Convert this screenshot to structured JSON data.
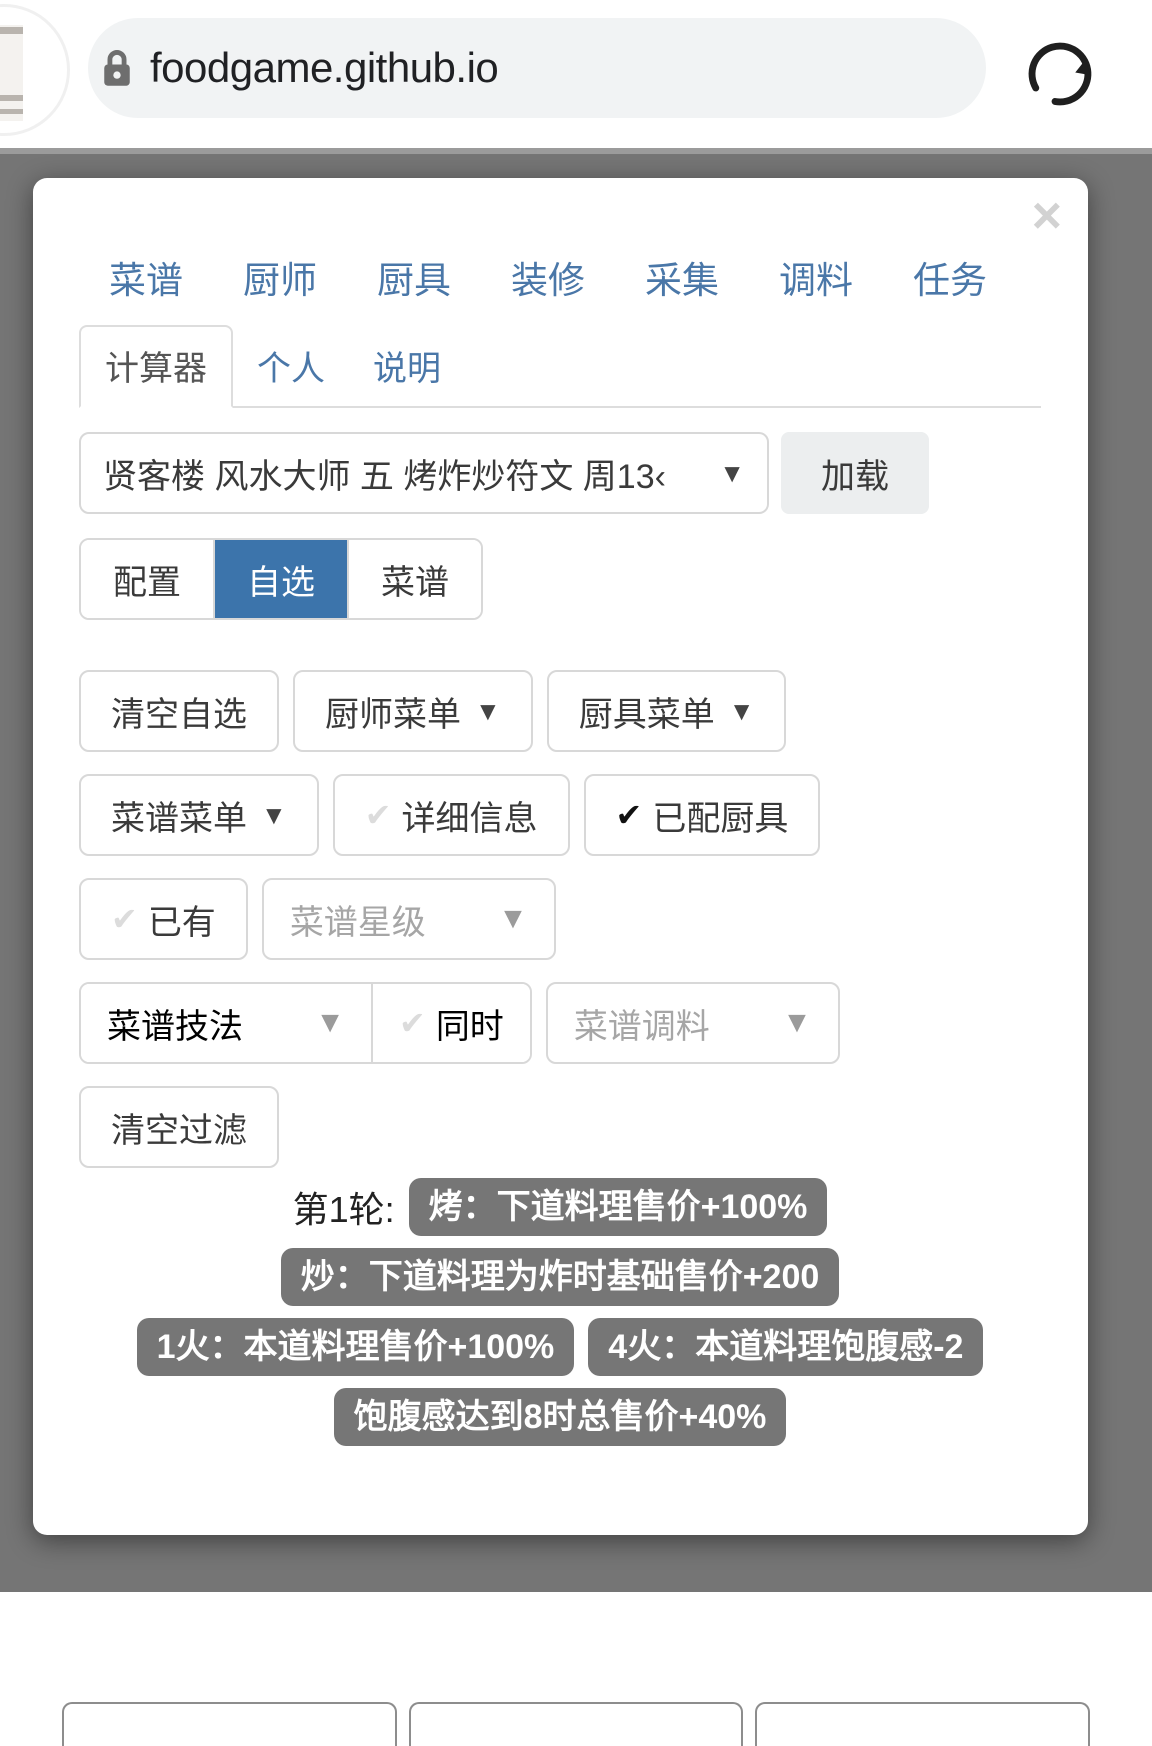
{
  "browser": {
    "url": "foodgame.github.io",
    "lock_icon": "lock-icon",
    "reload_icon": "reload-icon",
    "favicon_icon": "sad-toast-favicon"
  },
  "modal": {
    "close_label": "×"
  },
  "nav_tabs": [
    {
      "label": "菜谱"
    },
    {
      "label": "厨师"
    },
    {
      "label": "厨具"
    },
    {
      "label": "装修"
    },
    {
      "label": "采集"
    },
    {
      "label": "调料"
    },
    {
      "label": "任务"
    }
  ],
  "sub_tabs": [
    {
      "label": "计算器",
      "active": true
    },
    {
      "label": "个人",
      "active": false
    },
    {
      "label": "说明",
      "active": false
    }
  ],
  "preset": {
    "value": "贤客楼 风水大师 五 烤炸炒符文 周13‹",
    "caret": "▼",
    "load_label": "加载"
  },
  "mode_segments": [
    {
      "label": "配置",
      "selected": false
    },
    {
      "label": "自选",
      "selected": true
    },
    {
      "label": "菜谱",
      "selected": false
    }
  ],
  "controls": {
    "clear_custom": "清空自选",
    "chef_menu": "厨师菜单",
    "equip_menu": "厨具菜单",
    "recipe_menu": "菜谱菜单",
    "detail_info": "详细信息",
    "equipped": "已配厨具",
    "owned": "已有",
    "recipe_stars": "菜谱星级",
    "recipe_skill": "菜谱技法",
    "simultaneous": "同时",
    "recipe_condiment": "菜谱调料",
    "clear_filter": "清空过滤",
    "caret": "▼",
    "check": "✔"
  },
  "checks": {
    "detail_info": false,
    "equipped": true,
    "owned": false,
    "simultaneous": false
  },
  "results": {
    "round_label": "第1轮:",
    "badges_line1": [
      "烤：下道料理售价+100%"
    ],
    "badges_line2": [
      "炒：下道料理为炸时基础售价+200"
    ],
    "badges_line3": [
      "1火：本道料理售价+100%",
      "4火：本道料理饱腹感-2"
    ],
    "badges_line4": [
      "饱腹感达到8时总售价+40%"
    ]
  },
  "colors": {
    "accent_blue": "#3c74ab",
    "link_blue": "#4a77a8",
    "badge_gray": "#767676",
    "backdrop_gray": "#757575"
  }
}
